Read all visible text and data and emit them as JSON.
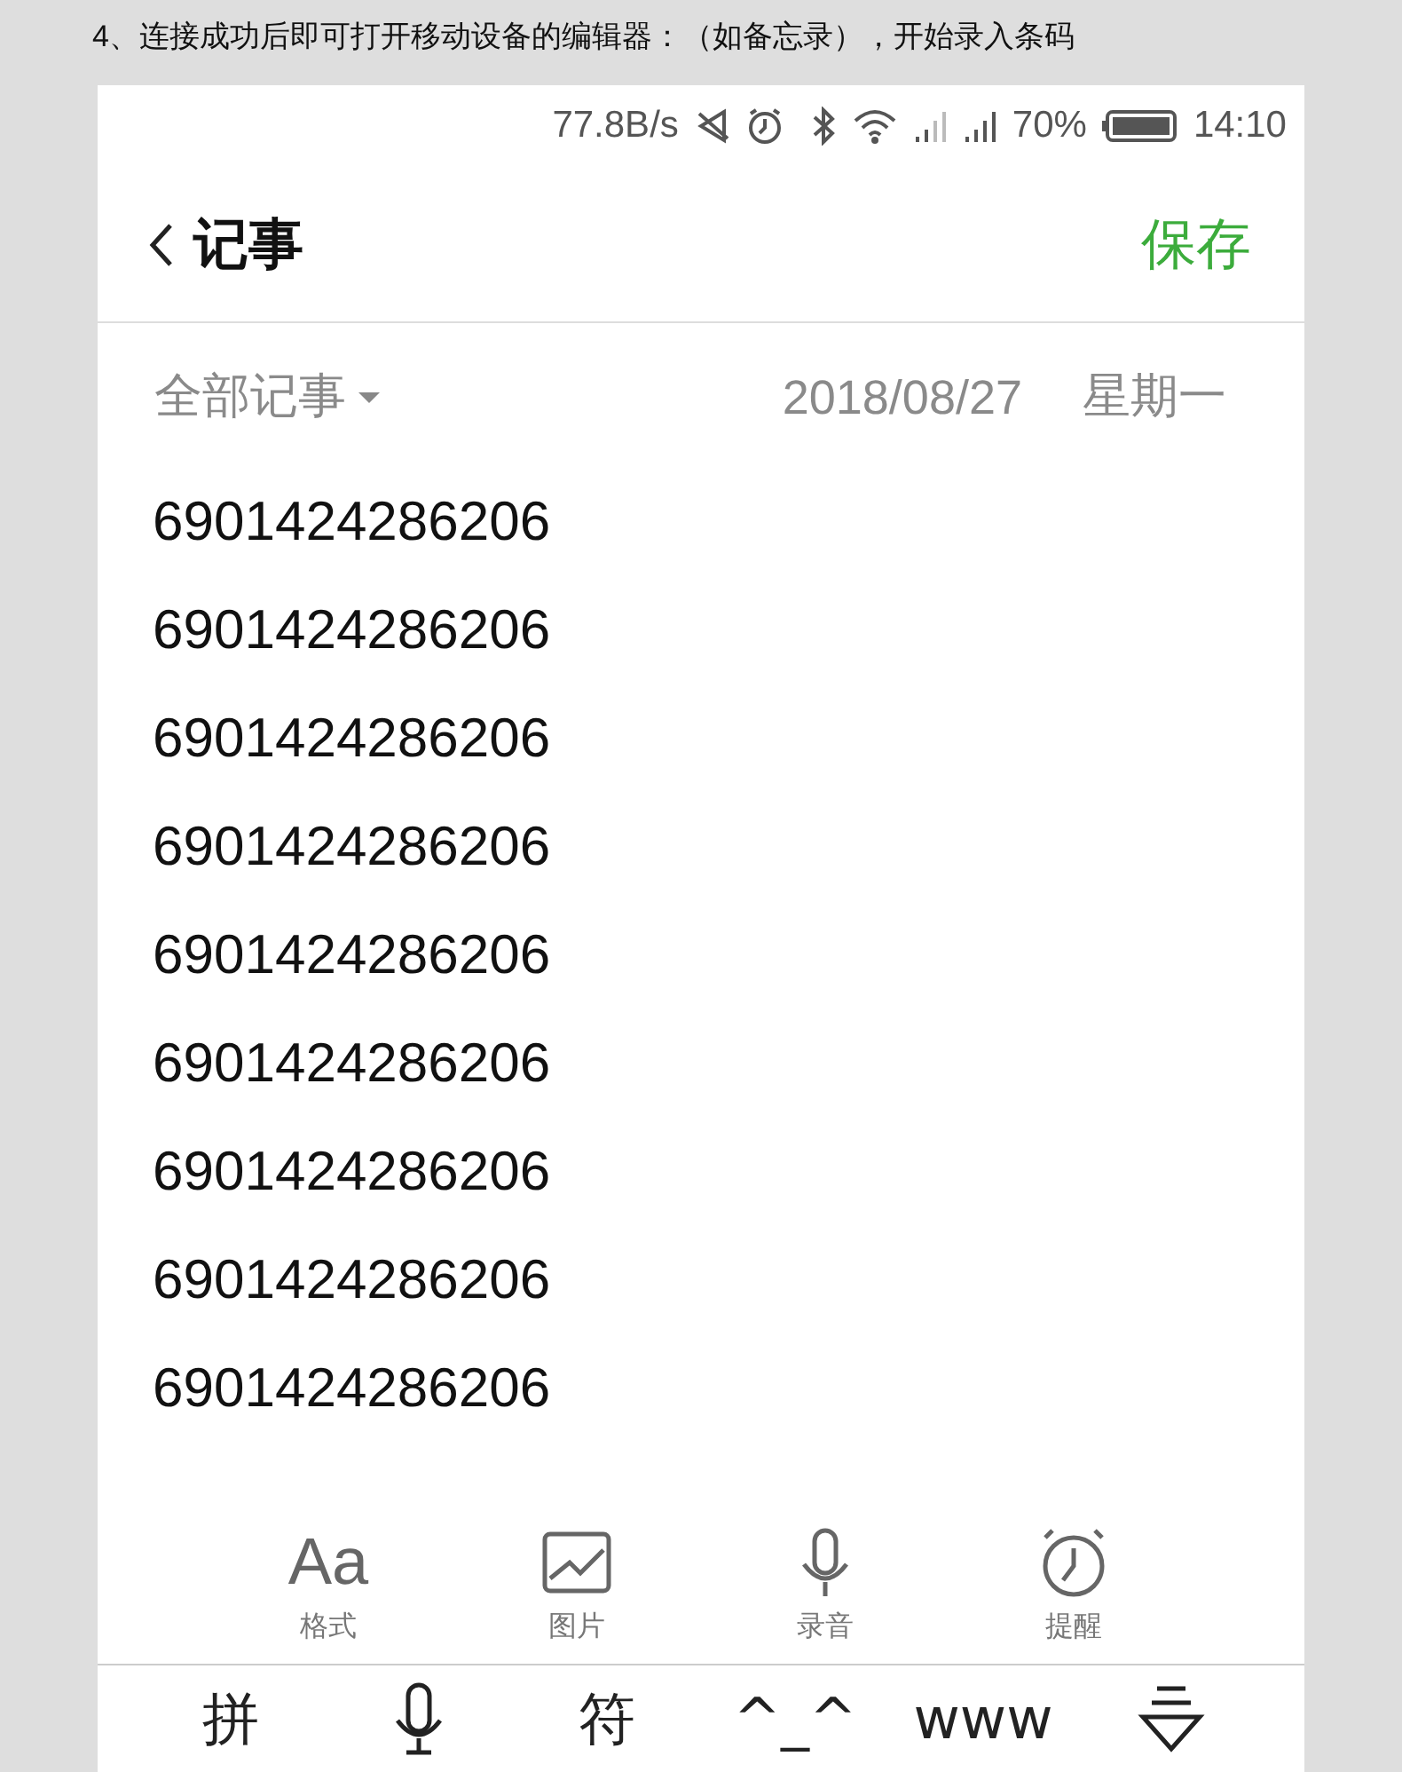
{
  "caption": "4、连接成功后即可打开移动设备的编辑器：（如备忘录），开始录入条码",
  "status_bar": {
    "speed": "77.8B/s",
    "battery": "70%",
    "time": "14:10"
  },
  "header": {
    "title": "记事",
    "save": "保存"
  },
  "filter": {
    "label": "全部记事",
    "date": "2018/08/27",
    "weekday": "星期一"
  },
  "lines": [
    "6901424286206",
    "6901424286206",
    "6901424286206",
    "6901424286206",
    "6901424286206",
    "6901424286206",
    "6901424286206",
    "6901424286206",
    "6901424286206"
  ],
  "toolbar": [
    {
      "kind": "text",
      "glyph": "Aa",
      "label": "格式"
    },
    {
      "kind": "image",
      "label": "图片"
    },
    {
      "kind": "mic",
      "label": "录音"
    },
    {
      "kind": "alarm",
      "label": "提醒"
    }
  ],
  "keyboard": [
    {
      "kind": "text",
      "label": "拼"
    },
    {
      "kind": "mic"
    },
    {
      "kind": "text",
      "label": "符"
    },
    {
      "kind": "text",
      "label": "^_^"
    },
    {
      "kind": "text",
      "label": "www"
    },
    {
      "kind": "hide"
    }
  ]
}
